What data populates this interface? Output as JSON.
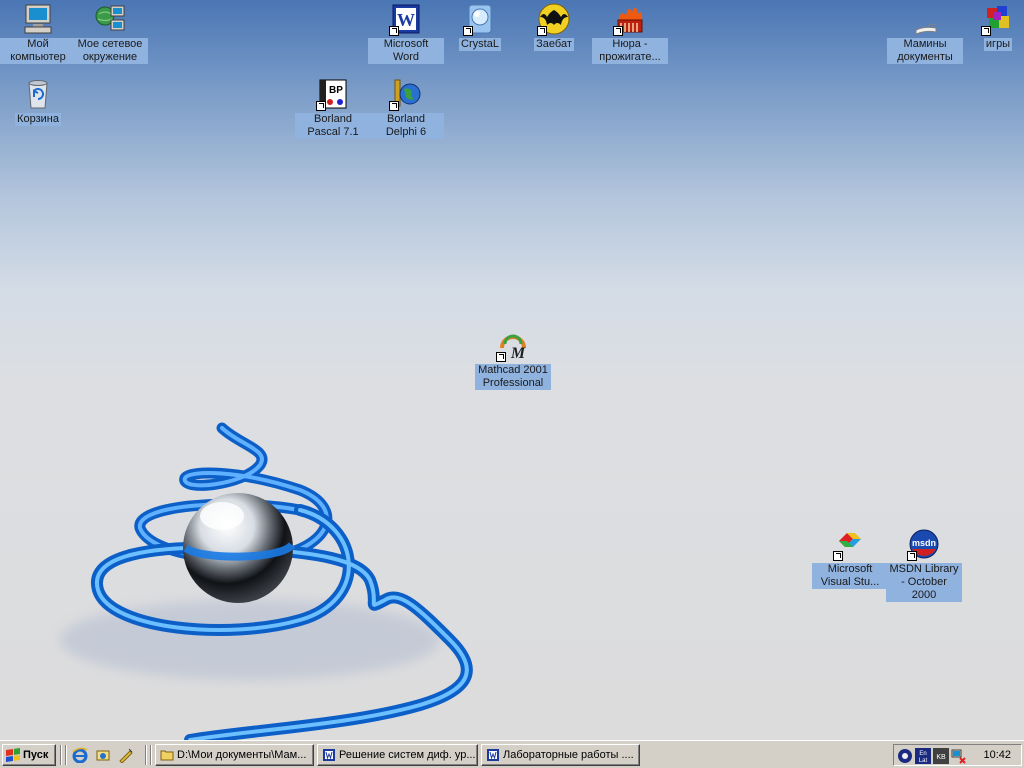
{
  "desktop": {
    "icons": {
      "my_computer": "Мой компьютер",
      "network": "Мое сетевое окружение",
      "recycle_bin": "Корзина",
      "ms_word": "Microsoft Word",
      "crystal": "CrystaL",
      "zaebat": "Заебат",
      "nero": "Нюра - прожигате...",
      "borland_pascal": "Borland Pascal 7.1",
      "borland_delphi": "Borland Delphi 6",
      "mathcad": "Mathcad 2001 Professional",
      "mamina_docs": "Мамины документы",
      "games": "игры",
      "visual_studio": "Microsoft Visual Stu...",
      "msdn": "MSDN Library - October 2000"
    },
    "icon_glyphs": {
      "bp": "BP",
      "msdn": "msdn",
      "mathcad": "M",
      "word": "W"
    }
  },
  "taskbar": {
    "start_label": "Пуск",
    "tasks": [
      "D:\\Мои документы\\Мам...",
      "Решение систем диф. ур...",
      "Лабораторные работы ...."
    ],
    "clock": "10:42",
    "tray_labels": {
      "lang": "En",
      "lat": "Lat",
      "kb": "KB"
    }
  },
  "colors": {
    "label_bg": "#8fb2de",
    "taskbar": "#d4d0c8",
    "spiral": "#1a7be6"
  }
}
